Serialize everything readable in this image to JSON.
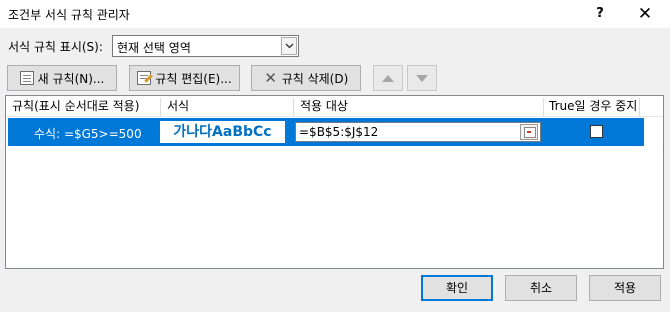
{
  "window": {
    "title": "조건부 서식 규칙 관리자",
    "help_glyph": "?",
    "close_glyph": "✕"
  },
  "show_rules": {
    "label": "서식 규칙 표시(S):",
    "selected": "현재 선택 영역"
  },
  "toolbar": {
    "new_rule": "새 규칙(N)...",
    "edit_rule": "규칙 편집(E)...",
    "delete_rule": "규칙 삭제(D)"
  },
  "table": {
    "headers": [
      "규칙(표시 순서대로 적용)",
      "서식",
      "적용 대상",
      "True일 경우 중지"
    ],
    "rows": [
      {
        "rule": "수식: =$G5>=500",
        "format_preview": "가나다AaBbCc",
        "applies_to": "=$B$5:$J$12",
        "stop_if_true": false
      }
    ]
  },
  "buttons": {
    "ok": "확인",
    "cancel": "취소",
    "apply": "적용"
  },
  "colors": {
    "selection": "#0078d7",
    "preview_text": "#0070c0"
  }
}
